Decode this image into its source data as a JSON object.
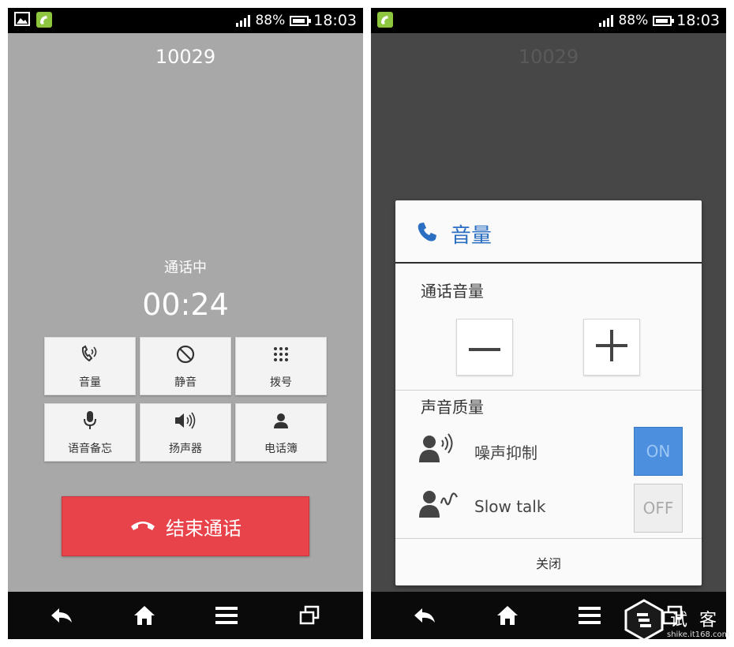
{
  "status_bar": {
    "battery": "88%",
    "time": "18:03"
  },
  "call": {
    "number": "10029",
    "state": "通话中",
    "duration": "00:24",
    "buttons": [
      {
        "label": "音量",
        "icon": "volume-phone-icon"
      },
      {
        "label": "静音",
        "icon": "mute-icon"
      },
      {
        "label": "拨号",
        "icon": "dialpad-icon"
      },
      {
        "label": "语音备忘",
        "icon": "microphone-icon"
      },
      {
        "label": "扬声器",
        "icon": "speaker-icon"
      },
      {
        "label": "电话簿",
        "icon": "contacts-icon"
      }
    ],
    "end_call_label": "结束通话"
  },
  "dialog": {
    "title": "音量",
    "call_volume_label": "通话音量",
    "sound_quality_label": "声音质量",
    "options": [
      {
        "label": "噪声抑制",
        "toggle": "ON",
        "state": true
      },
      {
        "label": "Slow talk",
        "toggle": "OFF",
        "state": false
      }
    ],
    "close_label": "关闭"
  },
  "navbar": {
    "icons": [
      "back-icon",
      "home-icon",
      "menu-icon",
      "recent-apps-icon"
    ]
  },
  "watermark": {
    "text": "试 客",
    "url": "shike.it168.com"
  },
  "colors": {
    "end_call": "#e8434a",
    "accent": "#2b6fc2",
    "toggle_on": "#4d8fdf"
  }
}
